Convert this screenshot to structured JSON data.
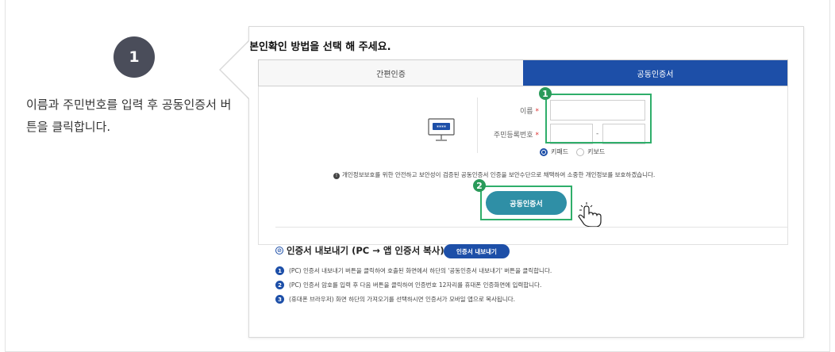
{
  "step": {
    "number": "1",
    "description": "이름과 주민번호를 입력 후 공동인증서 버튼을 클릭합니다."
  },
  "card": {
    "title": "본인확인 방법을 선택 해 주세요.",
    "tabs": [
      {
        "label": "간편인증",
        "active": false
      },
      {
        "label": "공동인증서",
        "active": true
      }
    ],
    "form": {
      "name_label": "이름",
      "rrn_label": "주민등록번호",
      "required_mark": "*",
      "hyphen": "-",
      "radio_keypad": "키패드",
      "radio_keyboard": "키보드",
      "pc_icon_text": "****"
    },
    "notice": "개인정보보호를 위한 안전하고 보안성이 검증된 공동인증서 인증을 보안수단으로 채택하여 소중한 개인정보를 보호하겠습니다.",
    "badge_1": "1",
    "badge_2": "2",
    "cert_button": "공동인증서",
    "export": {
      "title": "인증서 내보내기 (PC → 앱 인증서 복사)",
      "button": "인증서 내보내기",
      "steps": [
        {
          "num": "1",
          "text": "(PC) 인증서 내보내기 버튼을 클릭하여 호출된 화면에서 하단의 '공동인증서 내보내기' 버튼을 클릭합니다."
        },
        {
          "num": "2",
          "text": "(PC) 인증서 암호를 입력 후 다음 버튼을 클릭하여 인증번호 12자리를 휴대폰 인증화면에 입력합니다."
        },
        {
          "num": "3",
          "text": "(휴대폰 브라우저) 화면 하단의 가져오기를 선택하시면 인증서가 모바일 앱으로 복사됩니다."
        }
      ]
    }
  },
  "colors": {
    "accent": "#1d4fa8",
    "highlight": "#2fae6a",
    "button": "#2f8fa6"
  }
}
